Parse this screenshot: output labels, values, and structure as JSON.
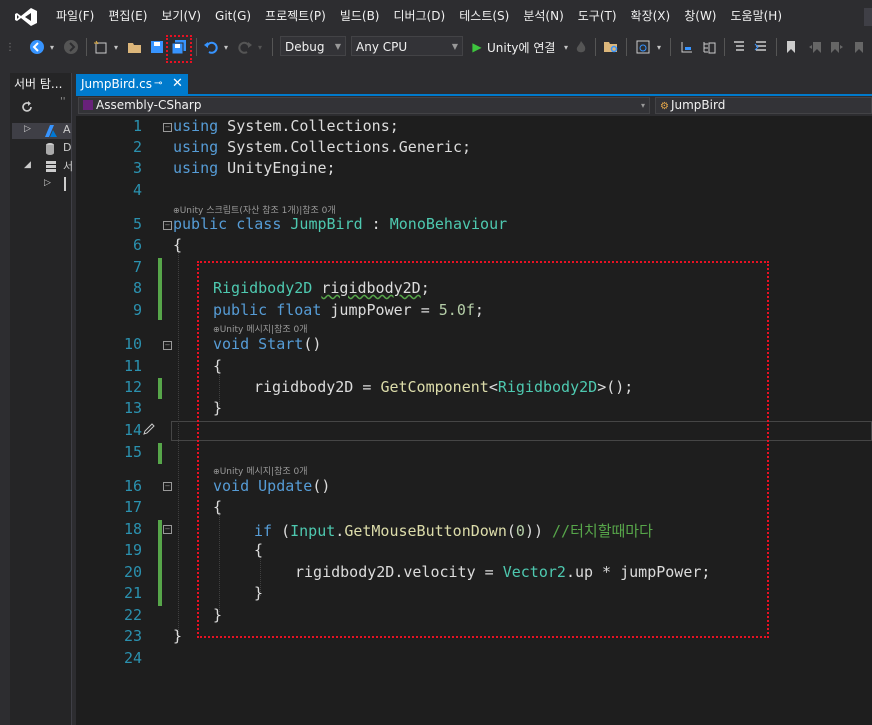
{
  "menu": {
    "items": [
      "파일(F)",
      "편집(E)",
      "보기(V)",
      "Git(G)",
      "프로젝트(P)",
      "빌드(B)",
      "디버그(D)",
      "테스트(S)",
      "분석(N)",
      "도구(T)",
      "확장(X)",
      "창(W)",
      "도움말(H)"
    ]
  },
  "toolbar": {
    "config": "Debug",
    "platform": "Any CPU",
    "run_label": "Unity에 연결"
  },
  "left_panel": {
    "tab_label": "서버 탐..."
  },
  "editor": {
    "tab_label": "JumpBird.cs",
    "nav_project": "Assembly-CSharp",
    "nav_class": "JumpBird"
  },
  "code": {
    "line_numbers": [
      "1",
      "2",
      "3",
      "4",
      "5",
      "6",
      "7",
      "8",
      "9",
      "10",
      "11",
      "12",
      "13",
      "14",
      "15",
      "16",
      "17",
      "18",
      "19",
      "20",
      "21",
      "22",
      "23",
      "24"
    ],
    "lens_class": "Unity 스크립트(자산 참조 1개)|참조 0개",
    "lens_start": "Unity 메시지|참조 0개",
    "lens_update": "Unity 메시지|참조 0개",
    "comment": "//터치할때마다"
  },
  "colors": {
    "accent": "#007acc",
    "highlight_box": "#e81123",
    "keyword": "#569cd6",
    "type": "#4ec9b0",
    "change_bar": "#57a64a"
  }
}
